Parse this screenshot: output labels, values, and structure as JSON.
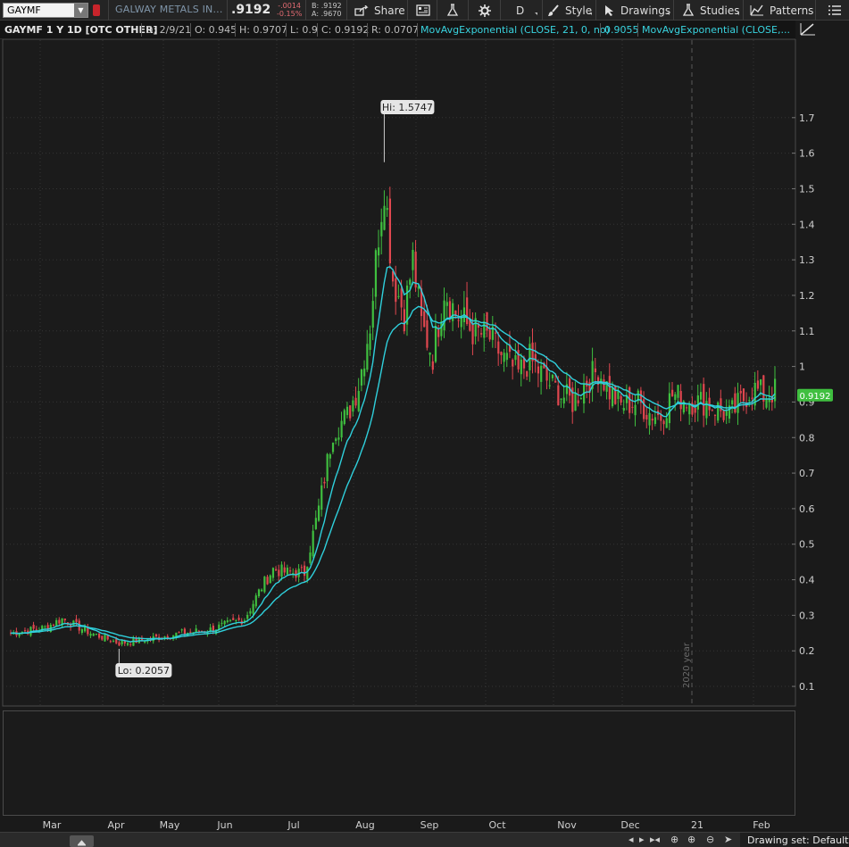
{
  "toolbar": {
    "symbol": "GAYMF",
    "company": "GALWAY METALS IN...",
    "last": ".9192",
    "net_change": "-.0014",
    "pct_change": "-0.15%",
    "bid": "B: .9192",
    "ask": "A: .9670",
    "share_label": "Share",
    "aggregation": "D",
    "style_label": "Style",
    "drawings_label": "Drawings",
    "studies_label": "Studies",
    "patterns_label": "Patterns"
  },
  "header": {
    "title": "GAYMF 1 Y 1D [OTC OTHER]",
    "date": "D: 2/9/21",
    "open": "O: 0.945",
    "high": "H: 0.9707",
    "low": "L: 0.9",
    "close": "C: 0.9192",
    "range": "R: 0.0707",
    "study1": "MovAvgExponential (CLOSE, 21, 0, no)",
    "study1_value": "0.9055",
    "study2": "MovAvgExponential (CLOSE,..."
  },
  "colors": {
    "up": "#3fbf3f",
    "down": "#e0474f",
    "ema": "#2fd0dc",
    "price_tag": "#3fbf3f"
  },
  "chart_data": {
    "type": "candlestick",
    "y_ticks": [
      "1.7",
      "1.6",
      "1.5",
      "1.4",
      "1.3",
      "1.2",
      "1.1",
      "1",
      "0.9",
      "0.8",
      "0.7",
      "0.6",
      "0.5",
      "0.4",
      "0.3",
      "0.2",
      "0.1"
    ],
    "ylim": [
      0.07,
      1.82
    ],
    "x_ticks": [
      "Mar",
      "Apr",
      "May",
      "Jun",
      "Jul",
      "Aug",
      "Sep",
      "Oct",
      "Nov",
      "Dec",
      "21",
      "Feb"
    ],
    "high_label": "Hi: 1.5747",
    "low_label": "Lo: 0.2057",
    "last_price_tag": "0.9192",
    "year_marker": "2020 year",
    "anchors": [
      [
        0,
        0.25
      ],
      [
        12,
        0.265
      ],
      [
        18,
        0.29
      ],
      [
        28,
        0.25
      ],
      [
        38,
        0.222
      ],
      [
        46,
        0.23
      ],
      [
        60,
        0.25
      ],
      [
        70,
        0.26
      ],
      [
        82,
        0.29
      ],
      [
        88,
        0.38
      ],
      [
        92,
        0.43
      ],
      [
        97,
        0.42
      ],
      [
        103,
        0.42
      ],
      [
        108,
        0.6
      ],
      [
        113,
        0.82
      ],
      [
        118,
        0.86
      ],
      [
        122,
        0.95
      ],
      [
        126,
        1.12
      ],
      [
        129,
        1.38
      ],
      [
        131,
        1.52
      ],
      [
        134,
        1.25
      ],
      [
        138,
        1.15
      ],
      [
        141,
        1.3
      ],
      [
        144,
        1.12
      ],
      [
        148,
        1.03
      ],
      [
        152,
        1.22
      ],
      [
        156,
        1.15
      ],
      [
        162,
        1.1
      ],
      [
        168,
        1.08
      ],
      [
        173,
        1.02
      ],
      [
        178,
        0.98
      ],
      [
        182,
        1.02
      ],
      [
        188,
        0.96
      ],
      [
        193,
        0.92
      ],
      [
        197,
        0.9
      ],
      [
        202,
        0.96
      ],
      [
        206,
        0.99
      ],
      [
        210,
        0.93
      ],
      [
        214,
        0.89
      ],
      [
        220,
        0.9
      ],
      [
        224,
        0.87
      ],
      [
        228,
        0.86
      ],
      [
        232,
        0.92
      ],
      [
        236,
        0.91
      ],
      [
        240,
        0.9
      ],
      [
        244,
        0.9
      ],
      [
        248,
        0.88
      ],
      [
        252,
        0.86
      ],
      [
        256,
        0.9
      ],
      [
        260,
        0.94
      ],
      [
        264,
        0.92
      ],
      [
        268,
        0.93
      ]
    ]
  },
  "footer": {
    "drawing_set": "Drawing set: Default"
  }
}
